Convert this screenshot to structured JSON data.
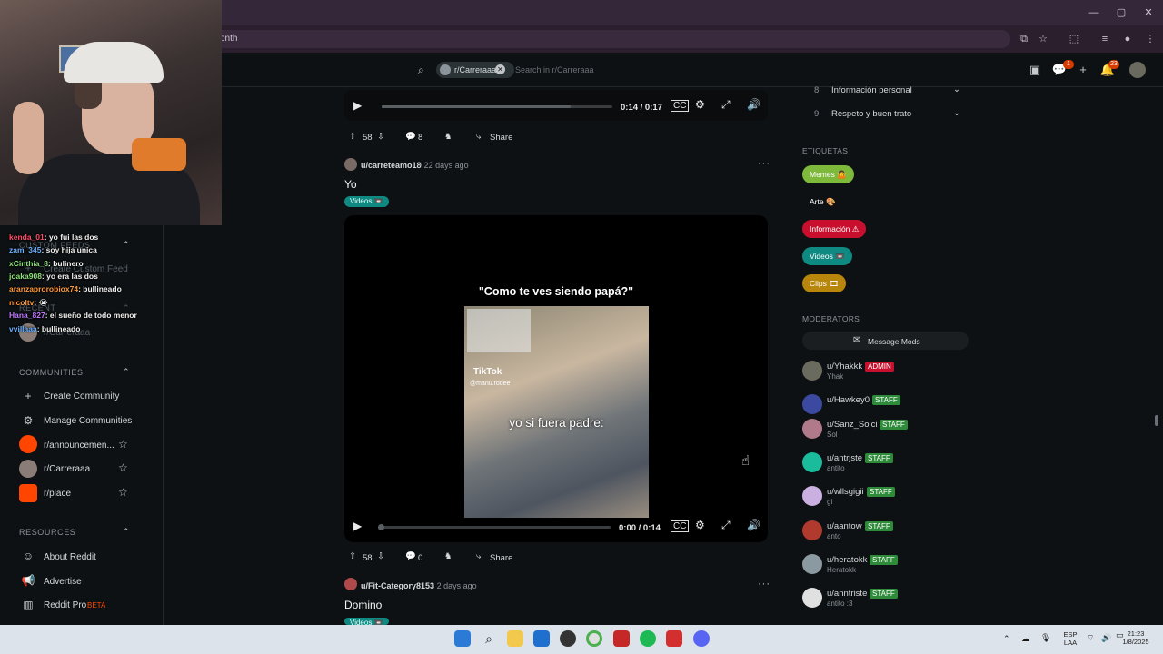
{
  "browser": {
    "url_fragment": "onth",
    "window_controls": [
      "minimize-icon",
      "maximize-icon",
      "close-icon"
    ]
  },
  "header": {
    "subreddit_chip": "r/Carreraaa",
    "search_placeholder": "Search in r/Carreraaa",
    "chat_badge": "1",
    "notif_badge": "23"
  },
  "chat": [
    {
      "user": "kenda_01",
      "msg": ": yo fui las dos",
      "color": "#ff4d6a"
    },
    {
      "user": "zam_345",
      "msg": ": soy hija unica",
      "color": "#6ab0ff"
    },
    {
      "user": "xCinthia_8",
      "msg": ": bulinero",
      "color": "#8ee07a"
    },
    {
      "user": "joaka908",
      "msg": ": yo era las dos",
      "color": "#8ee07a"
    },
    {
      "user": "aranzaprorobiox74",
      "msg": ": bullineado",
      "color": "#ff9a3c"
    },
    {
      "user": "nicoltv",
      "msg": ": 😭",
      "color": "#ff9a3c"
    },
    {
      "user": "Hana_827",
      "msg": ": el sueño de todo menor",
      "color": "#c07aff"
    },
    {
      "user": "vvillaaa",
      "msg": ": bullineado",
      "color": "#6ab0ff"
    }
  ],
  "sidebar": {
    "custom_feeds_head": "CUSTOM FEEDS",
    "create_custom_feed": "Create Custom Feed",
    "recent_head": "RECENT",
    "recent_items": [
      "r/Carreraaa"
    ],
    "communities_head": "COMMUNITIES",
    "communities": [
      {
        "label": "Create Community",
        "icon": "plus-icon"
      },
      {
        "label": "Manage Communities",
        "icon": "gear-icon"
      },
      {
        "label": "r/announcemen...",
        "color": "#ff4500"
      },
      {
        "label": "r/Carreraaa",
        "color": "#8a7d78"
      },
      {
        "label": "r/place",
        "color": "#ff4500"
      }
    ],
    "resources_head": "RESOURCES",
    "resources": [
      {
        "label": "About Reddit",
        "icon": "reddit-icon"
      },
      {
        "label": "Advertise",
        "icon": "megaphone-icon"
      },
      {
        "label": "Reddit Pro",
        "icon": "bar-chart-icon",
        "badge": "BETA"
      }
    ]
  },
  "feed": {
    "post1": {
      "time": "0:14 / 0:17",
      "progress": 0.82,
      "votes": "58",
      "comments": "8",
      "share": "Share"
    },
    "post2": {
      "user": "u/carreteamo18",
      "date": "• 22 days ago",
      "title": "Yo",
      "flair": "Videos 📼",
      "caption_top": "\"Como te ves siendo papá?\"",
      "tiktok": "TikTok",
      "tiktok_user": "@manu.rodee",
      "caption_mid": "yo si fuera padre:",
      "time": "0:00 / 0:14",
      "progress": 0.0,
      "votes": "58",
      "comments": "0",
      "share": "Share"
    },
    "post3": {
      "user": "u/Fit-Category8153",
      "date": "• 2 days ago",
      "title": "Domino",
      "flair": "Videos 📼"
    }
  },
  "right": {
    "rules": [
      {
        "num": "8",
        "label": "Información personal"
      },
      {
        "num": "9",
        "label": "Respeto y buen trato"
      }
    ],
    "tags_head": "ETIQUETAS",
    "tags": [
      {
        "label": "Memes 🤷",
        "color": "#7fb93c"
      },
      {
        "label": "Arte 🎨",
        "color": "#0e1113"
      },
      {
        "label": "Información ⚠",
        "color": "#c8102e"
      },
      {
        "label": "Videos 📼",
        "color": "#0e8a82"
      },
      {
        "label": "Clips 🎞",
        "color": "#b8860b"
      }
    ],
    "mods_head": "MODERATORS",
    "message_mods": "Message Mods",
    "mods": [
      {
        "name": "u/Yhakkk",
        "badge": "ADMIN",
        "badge_color": "#c8102e",
        "sub": "Yhak",
        "av": "#6b6a5e"
      },
      {
        "name": "u/Hawkey0",
        "badge": "STAFF",
        "badge_color": "#2e8b3a",
        "sub": "",
        "av": "#3b4aa0"
      },
      {
        "name": "u/Sanz_Solci",
        "badge": "STAFF",
        "badge_color": "#2e8b3a",
        "sub": "Sol",
        "av": "#b07a8a"
      },
      {
        "name": "u/antrjste",
        "badge": "STAFF",
        "badge_color": "#2e8b3a",
        "sub": "antito",
        "av": "#1abc9c"
      },
      {
        "name": "u/wllsgigii",
        "badge": "STAFF",
        "badge_color": "#2e8b3a",
        "sub": "gi",
        "av": "#c9b0e0"
      },
      {
        "name": "u/aantow",
        "badge": "STAFF",
        "badge_color": "#2e8b3a",
        "sub": "anto",
        "av": "#b03a2e"
      },
      {
        "name": "u/heratokk",
        "badge": "STAFF",
        "badge_color": "#2e8b3a",
        "sub": "Heratokk",
        "av": "#8a9aa0"
      },
      {
        "name": "u/anntriste",
        "badge": "STAFF",
        "badge_color": "#2e8b3a",
        "sub": "antito :3",
        "av": "#e0e0e0"
      }
    ]
  },
  "taskbar": {
    "lang": "ESP",
    "region": "LAA",
    "time": "21:23",
    "date": "1/8/2025"
  }
}
